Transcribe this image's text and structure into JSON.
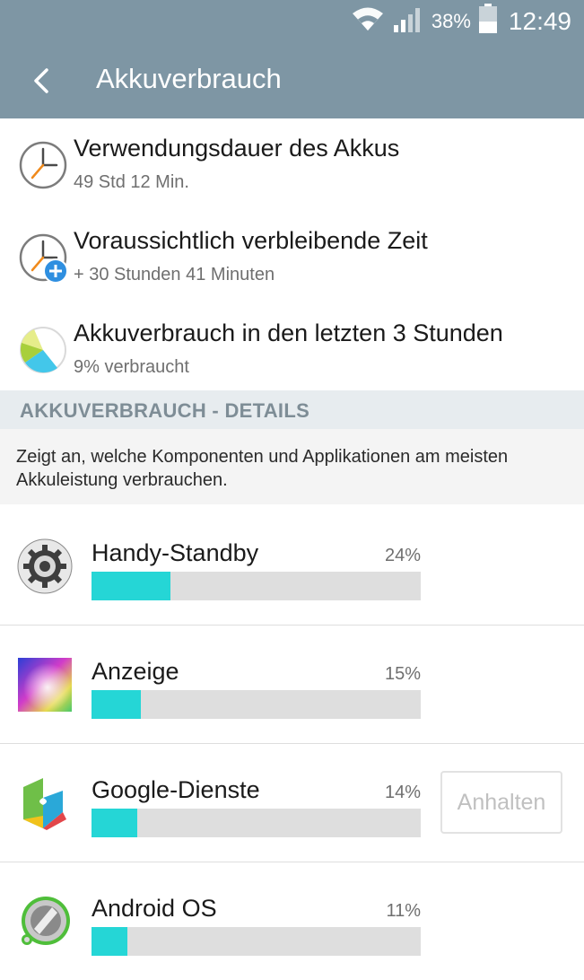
{
  "status_bar": {
    "battery_percent": "38%",
    "time": "12:49",
    "icons": [
      "wifi-icon",
      "signal-icon",
      "battery-icon"
    ]
  },
  "app_bar": {
    "title": "Akkuverbrauch",
    "back_icon": "back-arrow-icon"
  },
  "summary": [
    {
      "icon": "clock-icon",
      "title": "Verwendungsdauer des Akkus",
      "subtitle": "49 Std 12 Min."
    },
    {
      "icon": "clock-plus-icon",
      "title": "Voraussichtlich verbleibende Zeit",
      "subtitle": "+ 30 Stunden 41 Minuten"
    },
    {
      "icon": "pie-chart-icon",
      "title": "Akkuverbrauch in den letzten 3 Stunden",
      "subtitle": "9% verbraucht"
    }
  ],
  "details": {
    "header": "AKKUVERBRAUCH - DETAILS",
    "description": "Zeigt an, welche Komponenten und Applikationen am meisten Akkuleistung verbrauchen."
  },
  "apps": [
    {
      "icon": "settings-gear-icon",
      "name": "Handy-Standby",
      "percent_label": "24%",
      "usage_fraction": 0.24
    },
    {
      "icon": "display-icon",
      "name": "Anzeige",
      "percent_label": "15%",
      "usage_fraction": 0.15
    },
    {
      "icon": "google-services-icon",
      "name": "Google-Dienste",
      "percent_label": "14%",
      "usage_fraction": 0.14,
      "action_label": "Anhalten"
    },
    {
      "icon": "android-os-icon",
      "name": "Android OS",
      "percent_label": "11%",
      "usage_fraction": 0.11
    }
  ],
  "colors": {
    "header_bg": "#7e96a4",
    "accent_bar": "#25d6d6",
    "section_bg": "#e7ecef"
  }
}
